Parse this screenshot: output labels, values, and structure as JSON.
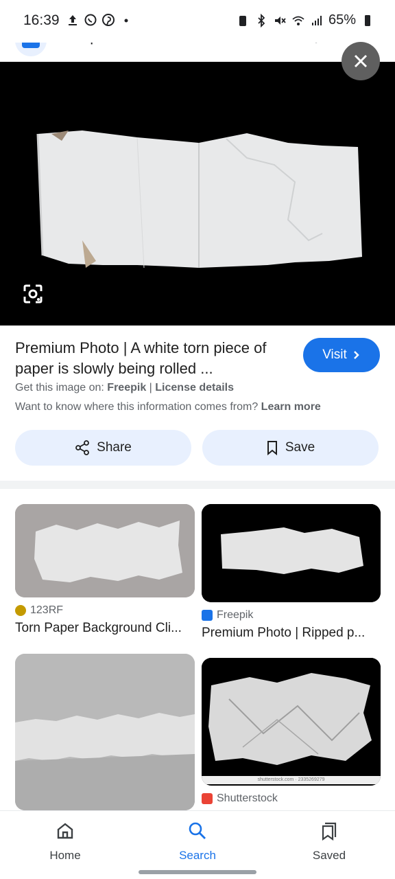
{
  "status_bar": {
    "time": "16:39",
    "battery": "65%"
  },
  "source_header": {
    "name": "Freepik"
  },
  "hero": {
    "close_icon": "close-icon",
    "lens_icon": "lens-icon"
  },
  "info": {
    "title": "Premium Photo | A white torn piece of paper is slowly being rolled ...",
    "visit_label": "Visit",
    "get_prefix": "Get this image on:",
    "get_source": "Freepik",
    "get_sep": "|",
    "license_label": "License details",
    "want_text": "Want to know where this information comes from?",
    "learn_more": "Learn more",
    "share_label": "Share",
    "save_label": "Save"
  },
  "results": [
    {
      "source": "123RF",
      "title": "Torn Paper Background Cli...",
      "source_color": "#c49a00"
    },
    {
      "source": "Freepik",
      "title": "Premium Photo | Ripped p...",
      "source_color": "#1a73e8"
    },
    {
      "source": "",
      "title": "",
      "source_color": ""
    },
    {
      "source": "Shutterstock",
      "title": "",
      "source_color": "#ea4335",
      "watermark": "shutterstock.com · 2335269279"
    }
  ],
  "bottom_nav": {
    "home": "Home",
    "search": "Search",
    "saved": "Saved"
  },
  "colors": {
    "accent": "#1a73e8",
    "button_bg": "#e8f0fe"
  }
}
